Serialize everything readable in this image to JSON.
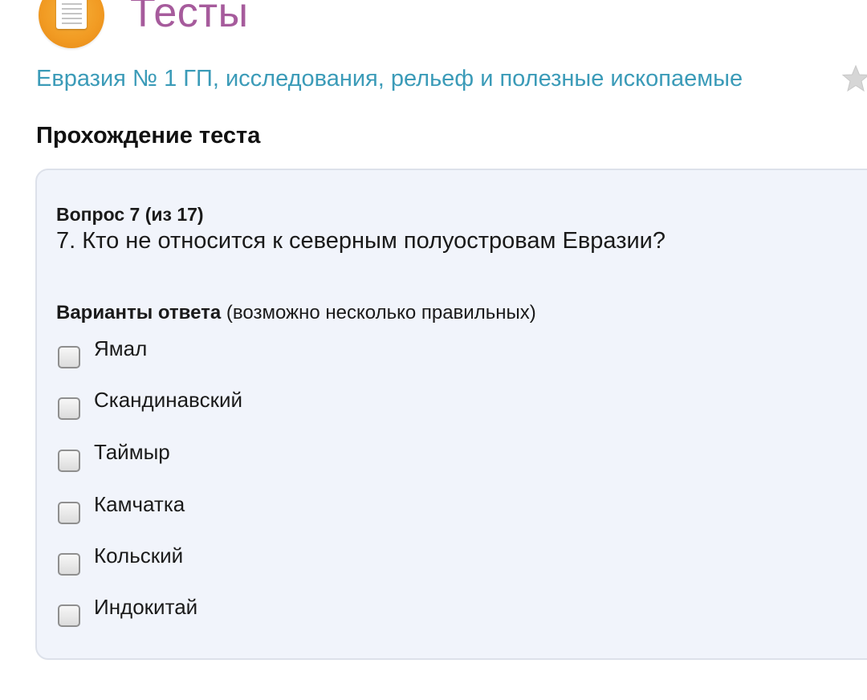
{
  "header": {
    "site_title": "Тесты",
    "logo_icon": "test-sheet-icon",
    "test_title": "Евразия № 1 ГП, исследования, рельеф и полезные ископаемые",
    "favorite_icon": "star-icon"
  },
  "section": {
    "heading": "Прохождение теста"
  },
  "question": {
    "number_label": "Вопрос 7 (из 17)",
    "text": "7. Кто не относится к северным полуостровам Евразии?",
    "answers_label_bold": "Варианты ответа",
    "answers_label_note": " (возможно несколько правильных)",
    "options": [
      {
        "label": "Ямал",
        "checked": false
      },
      {
        "label": "Скандинавский",
        "checked": false
      },
      {
        "label": "Таймыр",
        "checked": false
      },
      {
        "label": "Камчатка",
        "checked": false
      },
      {
        "label": "Кольский",
        "checked": false
      },
      {
        "label": "Индокитай",
        "checked": false
      }
    ]
  },
  "colors": {
    "site_title": "#a65b9c",
    "test_title_link": "#3b9bb8",
    "panel_background": "#f1f4fb",
    "logo_orange": "#f19a22"
  }
}
